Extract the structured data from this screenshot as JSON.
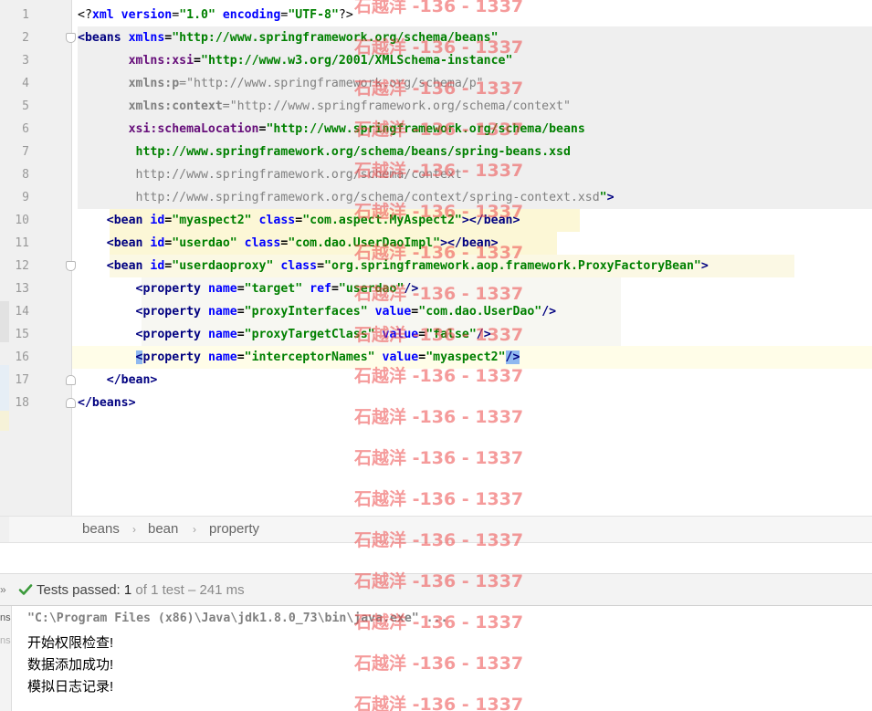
{
  "editor": {
    "line_numbers": [
      "1",
      "2",
      "3",
      "4",
      "5",
      "6",
      "7",
      "8",
      "9",
      "10",
      "11",
      "12",
      "13",
      "14",
      "15",
      "16",
      "17",
      "18"
    ],
    "lines": [
      [
        [
          "pi",
          "<?"
        ],
        [
          "attr",
          "xml version"
        ],
        [
          "pi",
          "="
        ],
        [
          "val",
          "\"1.0\""
        ],
        [
          "pi",
          " "
        ],
        [
          "attr",
          "encoding"
        ],
        [
          "pi",
          "="
        ],
        [
          "val",
          "\"UTF-8\""
        ],
        [
          "pi",
          "?>"
        ]
      ],
      [
        [
          "tag",
          "<beans "
        ],
        [
          "attr",
          "xmlns"
        ],
        [
          "plain",
          "="
        ],
        [
          "val",
          "\"http://www.springframework.org/schema/beans\""
        ]
      ],
      [
        [
          "plain",
          "       "
        ],
        [
          "nsp",
          "xmlns:xsi"
        ],
        [
          "plain",
          "="
        ],
        [
          "val",
          "\"http://www.w3.org/2001/XMLSchema-instance\""
        ]
      ],
      [
        [
          "plain",
          "       "
        ],
        [
          "dim",
          "xmlns:p"
        ],
        [
          "dimv",
          "=\"http://www.springframework.org/schema/p\""
        ]
      ],
      [
        [
          "plain",
          "       "
        ],
        [
          "dim",
          "xmlns:context"
        ],
        [
          "dimv",
          "=\"http://www.springframework.org/schema/context\""
        ]
      ],
      [
        [
          "plain",
          "       "
        ],
        [
          "nsp",
          "xsi:schemaLocation"
        ],
        [
          "plain",
          "="
        ],
        [
          "val",
          "\"http://www.springframework.org/schema/beans"
        ]
      ],
      [
        [
          "plain",
          "        "
        ],
        [
          "val",
          "http://www.springframework.org/schema/beans/spring-beans.xsd"
        ]
      ],
      [
        [
          "plain",
          "        "
        ],
        [
          "dimv",
          "http://www.springframework.org/schema/context"
        ]
      ],
      [
        [
          "plain",
          "        "
        ],
        [
          "dimv",
          "http://www.springframework.org/schema/context/spring-context.xsd"
        ],
        [
          "val",
          "\""
        ],
        [
          "tag",
          ">"
        ]
      ],
      [
        [
          "plain",
          "    "
        ],
        [
          "tag",
          "<bean "
        ],
        [
          "attr",
          "id"
        ],
        [
          "plain",
          "="
        ],
        [
          "val",
          "\"myaspect2\""
        ],
        [
          "plain",
          " "
        ],
        [
          "attr",
          "class"
        ],
        [
          "plain",
          "="
        ],
        [
          "val",
          "\"com.aspect.MyAspect2\""
        ],
        [
          "tag",
          "></bean>"
        ]
      ],
      [
        [
          "plain",
          "    "
        ],
        [
          "tag",
          "<bean "
        ],
        [
          "attr",
          "id"
        ],
        [
          "plain",
          "="
        ],
        [
          "val",
          "\"userdao\""
        ],
        [
          "plain",
          " "
        ],
        [
          "attr",
          "class"
        ],
        [
          "plain",
          "="
        ],
        [
          "val",
          "\"com.dao.UserDaoImpl\""
        ],
        [
          "tag",
          "></bean>"
        ]
      ],
      [
        [
          "plain",
          "    "
        ],
        [
          "tag",
          "<bean "
        ],
        [
          "attr",
          "id"
        ],
        [
          "plain",
          "="
        ],
        [
          "val",
          "\"userdaoproxy\""
        ],
        [
          "plain",
          " "
        ],
        [
          "attr",
          "class"
        ],
        [
          "plain",
          "="
        ],
        [
          "val",
          "\"org.springframework.aop.framework.ProxyFactoryBean\""
        ],
        [
          "tag",
          ">"
        ]
      ],
      [
        [
          "plain",
          "        "
        ],
        [
          "tag",
          "<property "
        ],
        [
          "attr",
          "name"
        ],
        [
          "plain",
          "="
        ],
        [
          "val",
          "\"target\""
        ],
        [
          "plain",
          " "
        ],
        [
          "attr",
          "ref"
        ],
        [
          "plain",
          "="
        ],
        [
          "val",
          "\"userdao\""
        ],
        [
          "tag",
          "/>"
        ]
      ],
      [
        [
          "plain",
          "        "
        ],
        [
          "tag",
          "<property "
        ],
        [
          "attr",
          "name"
        ],
        [
          "plain",
          "="
        ],
        [
          "val",
          "\"proxyInterfaces\""
        ],
        [
          "plain",
          " "
        ],
        [
          "attr",
          "value"
        ],
        [
          "plain",
          "="
        ],
        [
          "val",
          "\"com.dao.UserDao\""
        ],
        [
          "tag",
          "/>"
        ]
      ],
      [
        [
          "plain",
          "        "
        ],
        [
          "tag",
          "<property "
        ],
        [
          "attr",
          "name"
        ],
        [
          "plain",
          "="
        ],
        [
          "val",
          "\"proxyTargetClass\""
        ],
        [
          "plain",
          " "
        ],
        [
          "attr",
          "value"
        ],
        [
          "plain",
          "="
        ],
        [
          "val",
          "\"false\""
        ],
        [
          "tag",
          "/>"
        ]
      ],
      [
        [
          "plain",
          "        "
        ],
        [
          "caret",
          "<"
        ],
        [
          "tag",
          "property "
        ],
        [
          "attr",
          "name"
        ],
        [
          "plain",
          "="
        ],
        [
          "val",
          "\"interceptorNames\""
        ],
        [
          "plain",
          " "
        ],
        [
          "attr",
          "value"
        ],
        [
          "plain",
          "="
        ],
        [
          "val",
          "\"myaspect2\""
        ],
        [
          "caret",
          "/>"
        ]
      ],
      [
        [
          "plain",
          "    "
        ],
        [
          "tag",
          "</bean>"
        ]
      ],
      [
        [
          "tag",
          "</beans>"
        ]
      ]
    ]
  },
  "breadcrumb": {
    "items": [
      "beans",
      "bean",
      "property"
    ],
    "separator": "›"
  },
  "run": {
    "arrow": "»",
    "status_label": "Tests passed:",
    "passed_count": "1",
    "total_text": "of 1 test",
    "duration_text": "– 241 ms",
    "side_labels": [
      "ns",
      "ns"
    ]
  },
  "console": {
    "command": "\"C:\\Program Files (x86)\\Java\\jdk1.8.0_73\\bin\\java.exe\" ...",
    "output": [
      "开始权限检查!",
      "数据添加成功!",
      "模拟日志记录!"
    ]
  },
  "watermark": {
    "text": "石越洋 -136 - 1337"
  },
  "colors": {
    "tag": "#000080",
    "attribute": "#0000ff",
    "value": "#008000",
    "success": "#3b9a3b",
    "watermark": "#ec4848"
  }
}
